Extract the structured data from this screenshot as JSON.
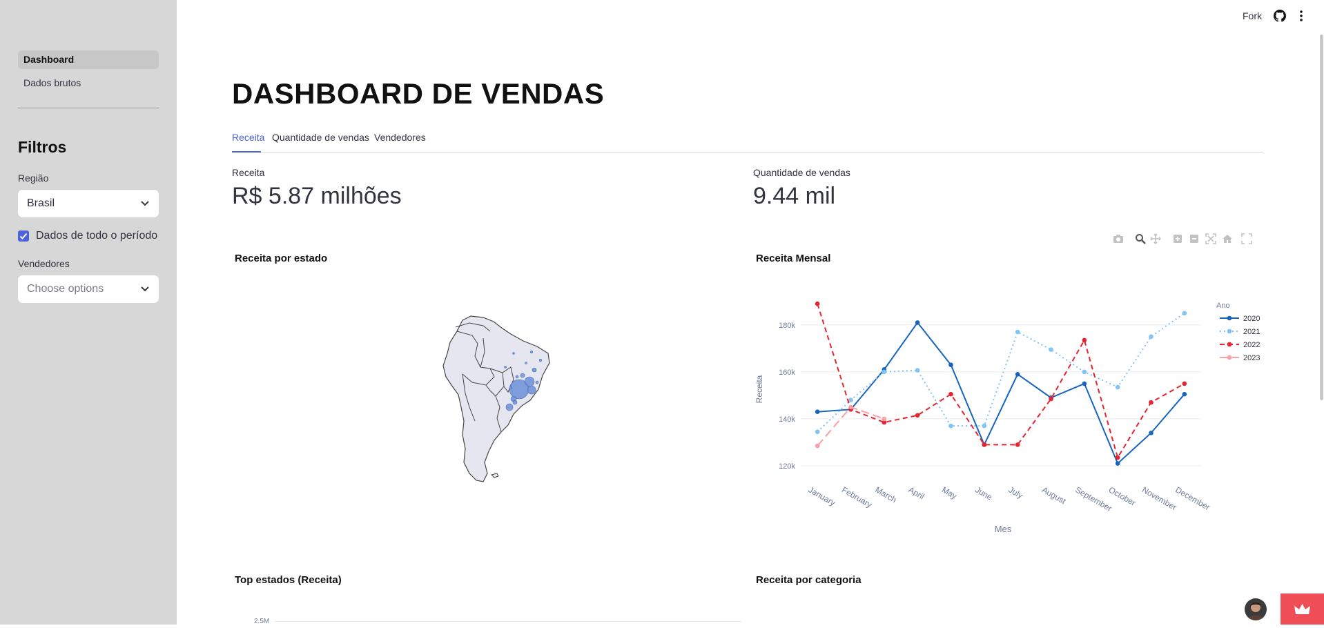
{
  "sidebar": {
    "nav": [
      {
        "label": "Dashboard",
        "active": true
      },
      {
        "label": "Dados brutos",
        "active": false
      }
    ],
    "filters_title": "Filtros",
    "region_label": "Região",
    "region_value": "Brasil",
    "period_checkbox_label": "Dados de todo o período",
    "period_checked": true,
    "sellers_label": "Vendedores",
    "sellers_placeholder": "Choose options"
  },
  "topbar": {
    "fork_label": "Fork",
    "icons": [
      "github-icon",
      "more-vertical-icon"
    ]
  },
  "main": {
    "title": "DASHBOARD DE VENDAS",
    "tabs": [
      {
        "label": "Receita",
        "active": true
      },
      {
        "label": "Quantidade de vendas",
        "active": false
      },
      {
        "label": "Vendedores",
        "active": false
      }
    ],
    "metrics": [
      {
        "label": "Receita",
        "value": "R$ 5.87 milhões"
      },
      {
        "label": "Quantidade de vendas",
        "value": "9.44 mil"
      }
    ],
    "map_title": "Receita por estado",
    "line_title": "Receita Mensal",
    "bar_title": "Top estados (Receita)",
    "category_title": "Receita por categoria",
    "bar_axis_tick": "2.5M",
    "modebar_icons": [
      "camera-icon",
      "zoom-icon",
      "pan-icon",
      "zoom-in-icon",
      "zoom-out-icon",
      "autoscale-icon",
      "home-icon",
      "fullscreen-icon"
    ]
  },
  "chart_data": [
    {
      "type": "line",
      "title": "Receita Mensal",
      "xlabel": "Mes",
      "ylabel": "Receita",
      "legend_title": "Ano",
      "legend_position": "right",
      "grid": true,
      "ylim": [
        115000,
        192000
      ],
      "yticks": [
        "120k",
        "140k",
        "160k",
        "180k"
      ],
      "ytick_values": [
        120000,
        140000,
        160000,
        180000
      ],
      "categories": [
        "January",
        "February",
        "March",
        "April",
        "May",
        "June",
        "July",
        "August",
        "September",
        "October",
        "November",
        "December"
      ],
      "series": [
        {
          "name": "2020",
          "color": "#1565c0",
          "dash": "solid",
          "values": [
            143000,
            144000,
            161000,
            181000,
            163000,
            129000,
            159000,
            149000,
            155000,
            121000,
            134000,
            150500
          ]
        },
        {
          "name": "2021",
          "color": "#7fc4f5",
          "dash": "dot",
          "values": [
            134500,
            148000,
            160000,
            160700,
            137000,
            137000,
            177000,
            169500,
            160000,
            153500,
            175000,
            185000
          ]
        },
        {
          "name": "2022",
          "color": "#e8232f",
          "dash": "dash",
          "values": [
            189000,
            144000,
            138500,
            141500,
            150500,
            129000,
            129000,
            148500,
            173500,
            123500,
            147000,
            155000
          ]
        },
        {
          "name": "2023",
          "color": "#f7a0a6",
          "dash": "longdash",
          "values": [
            128500,
            145000,
            140000
          ]
        }
      ]
    }
  ],
  "colors": {
    "accent": "#4b63d9",
    "sidebar_bg": "#d7d7d7",
    "map_bubble": "#6b8fd6"
  }
}
